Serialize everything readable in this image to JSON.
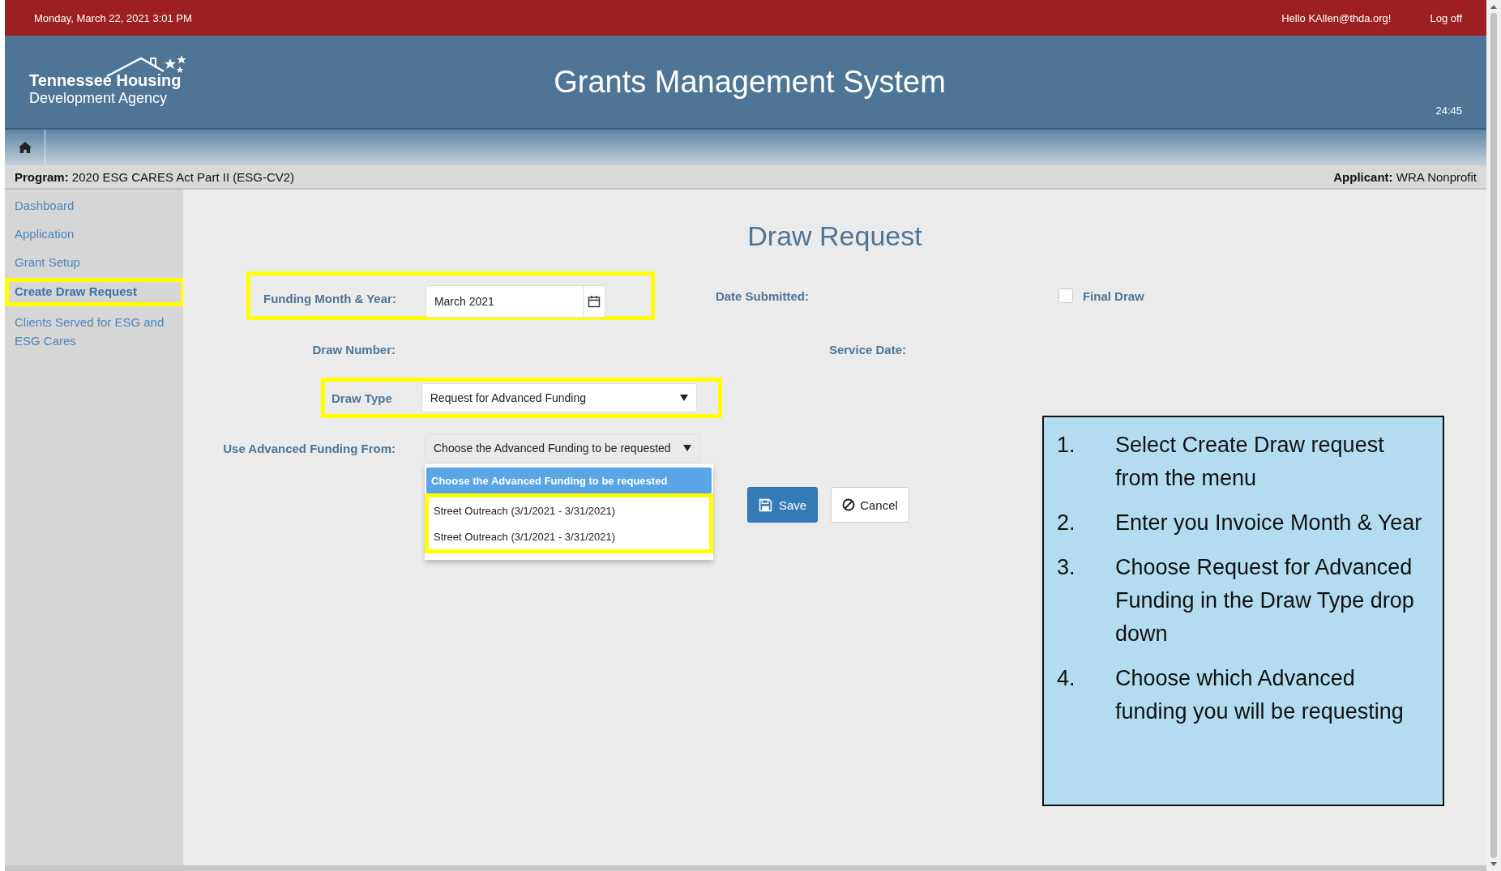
{
  "top_bar": {
    "date": "Monday, March 22, 2021 3:01 PM",
    "greeting": "Hello KAllen@thda.org!",
    "logoff": "Log off"
  },
  "header": {
    "logo_line1": "Tennessee Housing",
    "logo_line2": "Development Agency",
    "title": "Grants Management System",
    "timer": "24:45"
  },
  "info_bar": {
    "program_label": "Program:",
    "program": "2020 ESG CARES Act Part II (ESG-CV2)",
    "applicant_label": "Applicant:",
    "applicant": "WRA Nonprofit"
  },
  "sidebar": {
    "items": [
      {
        "label": "Dashboard",
        "selected": false,
        "highlighted": false
      },
      {
        "label": "Application",
        "selected": false,
        "highlighted": false
      },
      {
        "label": "Grant Setup",
        "selected": false,
        "highlighted": false
      },
      {
        "label": "Create Draw Request",
        "selected": true,
        "highlighted": true
      },
      {
        "label": "Clients Served for ESG and ESG Cares",
        "selected": false,
        "highlighted": false
      }
    ]
  },
  "form": {
    "title": "Draw Request",
    "funding_month": {
      "label": "Funding Month & Year:",
      "value": "March 2021",
      "highlighted": true
    },
    "date_submitted": {
      "label": "Date Submitted:"
    },
    "final_draw": {
      "label": "Final Draw",
      "checked": false
    },
    "draw_number": {
      "label": "Draw Number:"
    },
    "service_date": {
      "label": "Service Date:"
    },
    "draw_type": {
      "label": "Draw Type",
      "value": "Request for Advanced Funding",
      "highlighted": true
    },
    "advanced_funding": {
      "label": "Use Advanced Funding From:",
      "value": "Choose the Advanced Funding to be requested",
      "expanded": true,
      "options": [
        {
          "label": "Choose the Advanced Funding to be requested",
          "selected": true,
          "highlighted": false
        },
        {
          "label": "Street Outreach (3/1/2021 - 3/31/2021)",
          "selected": false,
          "highlighted": true
        },
        {
          "label": "Street Outreach (3/1/2021 - 3/31/2021)",
          "selected": false,
          "highlighted": true
        }
      ]
    },
    "save": "Save",
    "cancel": "Cancel"
  },
  "instructions": [
    {
      "number": "1.",
      "text": "Select Create Draw request from the menu"
    },
    {
      "number": "2.",
      "text": "Enter you Invoice Month & Year"
    },
    {
      "number": "3.",
      "text": "Choose Request for Advanced Funding in the Draw Type drop down"
    },
    {
      "number": "4.",
      "text": "Choose which Advanced funding you will be requesting"
    }
  ]
}
